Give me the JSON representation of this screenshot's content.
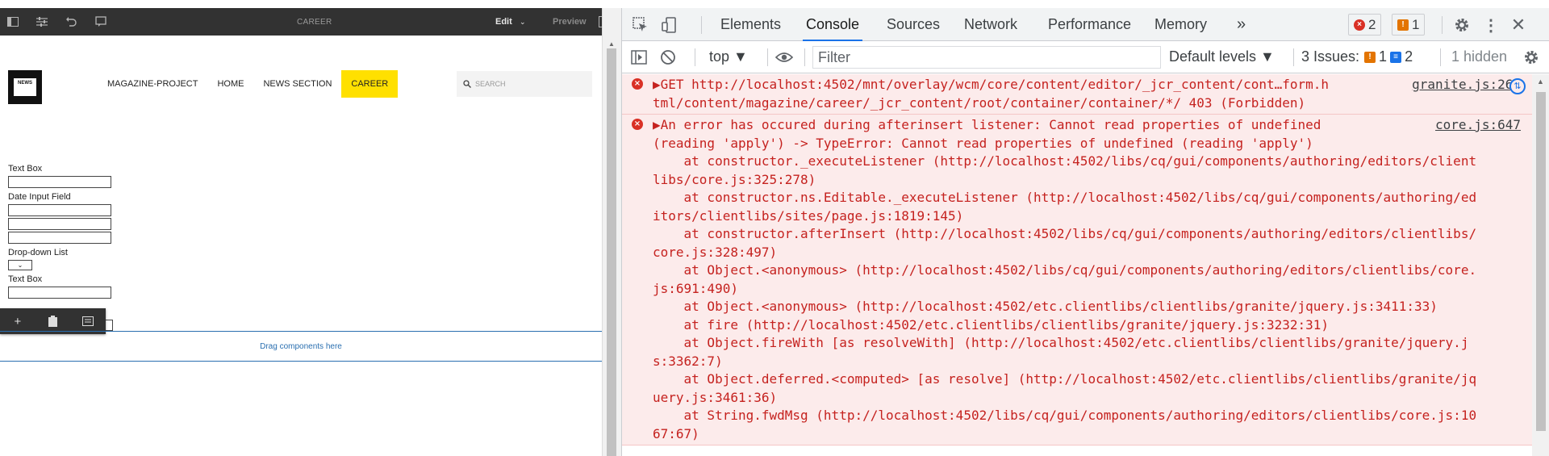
{
  "editor": {
    "page_name": "CAREER",
    "mode_label": "Edit",
    "preview_label": "Preview",
    "logo_text": "NEWS",
    "nav": [
      "MAGAZINE-PROJECT",
      "HOME",
      "NEWS SECTION",
      "CAREER"
    ],
    "nav_active": "CAREER",
    "search_placeholder": "SEARCH",
    "form": {
      "label_text_box_1": "Text Box",
      "label_date": "Date Input Field",
      "label_dropdown": "Drop-down List",
      "label_text_box_2": "Text Box"
    },
    "drag_hint": "Drag components here",
    "toolbar_icons": [
      "add-icon",
      "paste-icon",
      "parent-icon"
    ]
  },
  "devtools": {
    "tabs": [
      "Elements",
      "Console",
      "Sources",
      "Network",
      "Performance",
      "Memory"
    ],
    "active_tab": "Console",
    "more_tabs": "»",
    "error_count": "2",
    "warning_count": "1",
    "context": "top ▼",
    "filter_placeholder": "Filter",
    "levels": "Default levels ▼",
    "issues_label": "3 Issues:",
    "issues_warn": "1",
    "issues_info": "2",
    "hidden": "1 hidden",
    "messages": [
      {
        "source": "granite.js:266",
        "lines": [
          "▶GET http://localhost:4502/mnt/overlay/wcm/core/content/editor/_jcr_content/cont…form.h",
          "tml/content/magazine/career/_jcr_content/root/container/container/*/ 403 (Forbidden)"
        ]
      },
      {
        "source": "core.js:647",
        "lines": [
          "▶An error has occured during afterinsert listener: Cannot read properties of undefined",
          "(reading 'apply') -> TypeError: Cannot read properties of undefined (reading 'apply')",
          "    at constructor._executeListener (http://localhost:4502/libs/cq/gui/components/authoring/editors/client",
          "libs/core.js:325:278)",
          "    at constructor.ns.Editable._executeListener (http://localhost:4502/libs/cq/gui/components/authoring/ed",
          "itors/clientlibs/sites/page.js:1819:145)",
          "    at constructor.afterInsert (http://localhost:4502/libs/cq/gui/components/authoring/editors/clientlibs/",
          "core.js:328:497)",
          "    at Object.<anonymous> (http://localhost:4502/libs/cq/gui/components/authoring/editors/clientlibs/core.",
          "js:691:490)",
          "    at Object.<anonymous> (http://localhost:4502/etc.clientlibs/clientlibs/granite/jquery.js:3411:33)",
          "    at fire (http://localhost:4502/etc.clientlibs/clientlibs/granite/jquery.js:3232:31)",
          "    at Object.fireWith [as resolveWith] (http://localhost:4502/etc.clientlibs/clientlibs/granite/jquery.j",
          "s:3362:7)",
          "    at Object.deferred.<computed> [as resolve] (http://localhost:4502/etc.clientlibs/clientlibs/granite/jq",
          "uery.js:3461:36)",
          "    at String.fwdMsg (http://localhost:4502/libs/cq/gui/components/authoring/editors/clientlibs/core.js:10",
          "67:67)"
        ]
      }
    ]
  }
}
